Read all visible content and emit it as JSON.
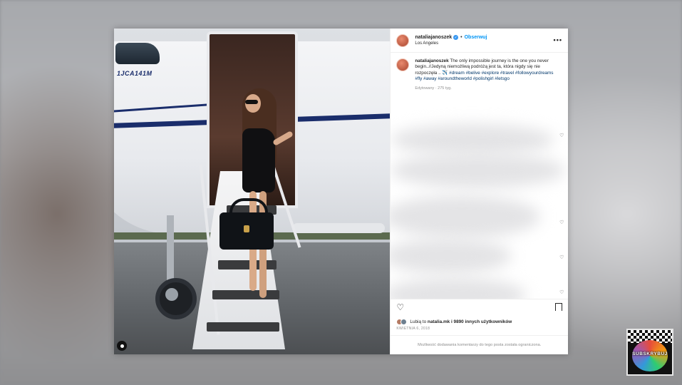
{
  "post": {
    "username": "nataliajanoszek",
    "follow_label": "Obserwuj",
    "separator": "•",
    "location": "Los Angeles",
    "more_label": "•••",
    "caption": {
      "text": "The only impossible journey is the one you never begin..//Jedyną niemożliwą podróżą jest ta, która nigdy się nie rozpoczęła .. ✈️",
      "hashtags": "#dream #belive #explore #travel #followyourdreams #fly #away #aroundtheworld #polishgirl #letsgo",
      "meta": "Edytowany · 275 tyg."
    },
    "likes": {
      "prefix": "Lubią to ",
      "user": "natalia.mk",
      "suffix": " i 9890 innych użytkowników"
    },
    "date": "KWIETNIA 6, 2018",
    "footer": "Możliwość dodawania komentarzy do tego posta została ograniczona.",
    "photo_text": {
      "tail_number": "1JCA141M"
    }
  },
  "badge": {
    "label": "SUBSKRYBUJ"
  },
  "colors": {
    "accent": "#0095f6",
    "hashtag": "#00376b",
    "verified": "#3897f0",
    "stripe": "#1a2d6b"
  },
  "icons": {
    "more": "more-icon",
    "heart": "heart-icon",
    "bookmark": "bookmark-icon",
    "tag": "tag-icon",
    "verified": "verified-icon"
  }
}
